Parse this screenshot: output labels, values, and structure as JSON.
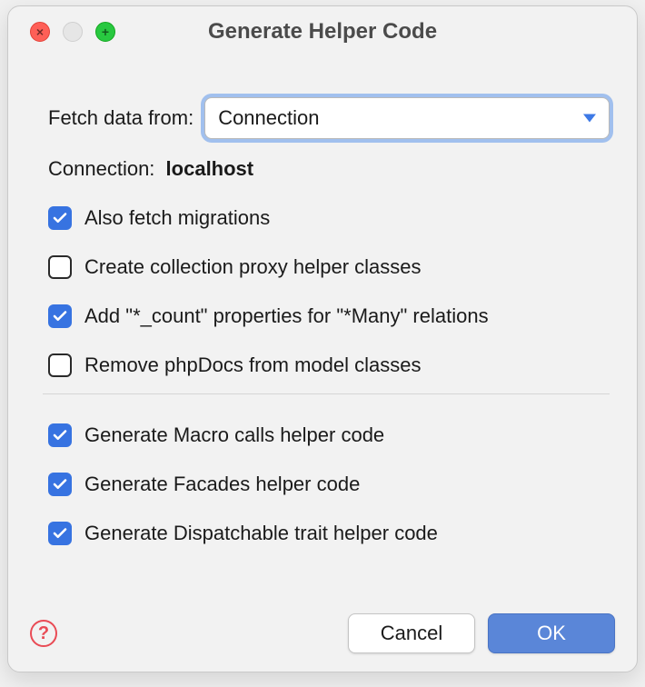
{
  "window": {
    "title": "Generate Helper Code"
  },
  "fetch": {
    "label": "Fetch data from:",
    "selected": "Connection"
  },
  "connection": {
    "label": "Connection:",
    "value": "localhost"
  },
  "options_a": [
    {
      "key": "also_fetch_migrations",
      "label": "Also fetch migrations",
      "checked": true
    },
    {
      "key": "create_collection_proxy",
      "label": "Create collection proxy helper classes",
      "checked": false
    },
    {
      "key": "add_count_props",
      "label": "Add \"*_count\" properties for \"*Many\" relations",
      "checked": true
    },
    {
      "key": "remove_phpdocs",
      "label": "Remove phpDocs from model classes",
      "checked": false
    }
  ],
  "options_b": [
    {
      "key": "gen_macro",
      "label": "Generate Macro calls helper code",
      "checked": true
    },
    {
      "key": "gen_facades",
      "label": "Generate Facades helper code",
      "checked": true
    },
    {
      "key": "gen_dispatchable",
      "label": "Generate Dispatchable trait helper code",
      "checked": true
    }
  ],
  "buttons": {
    "cancel": "Cancel",
    "ok": "OK"
  }
}
